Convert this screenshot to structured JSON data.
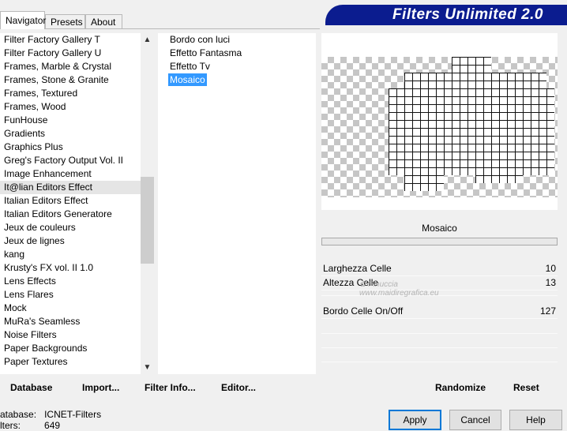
{
  "tabs": [
    "Navigator",
    "Presets",
    "About"
  ],
  "banner": "Filters Unlimited 2.0",
  "categories": [
    "Filter Factory Gallery T",
    "Filter Factory Gallery U",
    "Frames, Marble & Crystal",
    "Frames, Stone & Granite",
    "Frames, Textured",
    "Frames, Wood",
    "FunHouse",
    "Gradients",
    "Graphics Plus",
    "Greg's Factory Output Vol. II",
    "Image Enhancement",
    "It@lian Editors Effect",
    "Italian Editors Effect",
    "Italian Editors Generatore",
    "Jeux de couleurs",
    "Jeux de lignes",
    "kang",
    "Krusty's FX vol. II 1.0",
    "Lens Effects",
    "Lens Flares",
    "Mock",
    "MuRa's Seamless",
    "Noise Filters",
    "Paper Backgrounds",
    "Paper Textures"
  ],
  "selected_category_index": 11,
  "filters": [
    "Bordo con luci",
    "Effetto Fantasma",
    "Effetto Tv",
    "Mosaico"
  ],
  "selected_filter_index": 3,
  "filter_name": "Mosaico",
  "params": [
    {
      "label": "Larghezza Celle",
      "value": "10"
    },
    {
      "label": "Altezza Celle",
      "value": "13"
    },
    {
      "label": "Bordo Celle On/Off",
      "value": "127"
    }
  ],
  "watermark": "Pinuccia\nwww.maidiregrafica.eu",
  "links": {
    "database": "Database",
    "import": "Import...",
    "filter_info": "Filter Info...",
    "editor": "Editor..."
  },
  "randomize": "Randomize",
  "reset": "Reset",
  "status": {
    "db_label": "atabase:",
    "db_value": "ICNET-Filters",
    "filters_label": "lters:",
    "filters_value": "649"
  },
  "buttons": {
    "apply": "Apply",
    "cancel": "Cancel",
    "help": "Help"
  }
}
